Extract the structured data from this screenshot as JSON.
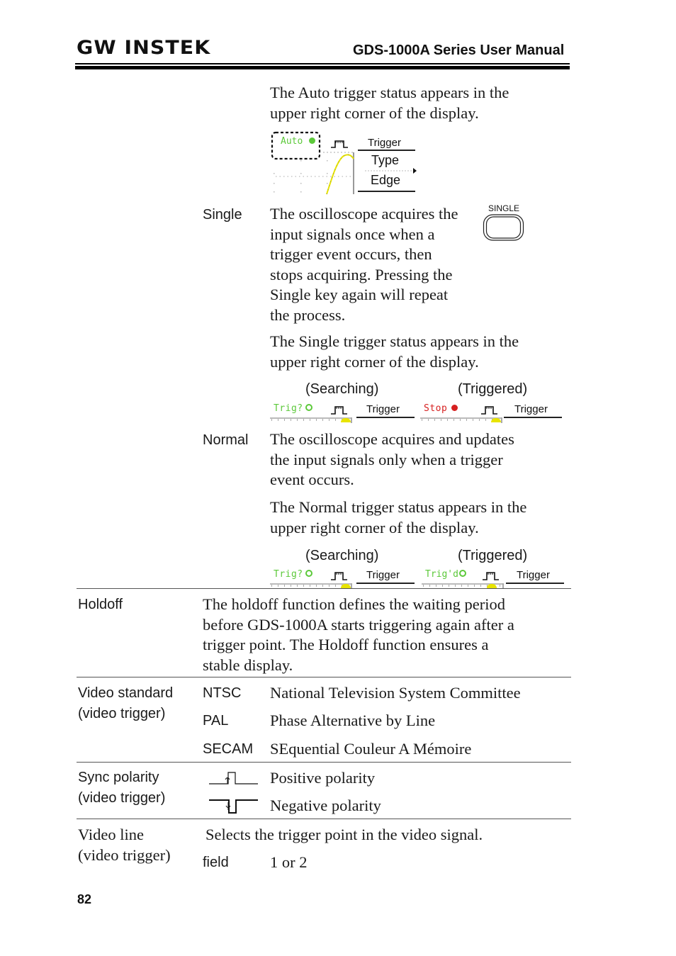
{
  "header": {
    "logo": "GW INSTEK",
    "manual_title": "GDS-1000A Series User Manual"
  },
  "auto": {
    "description": "The Auto trigger status appears in the upper right corner of the display.",
    "lines": [
      "The Auto trigger status appears in the",
      "upper right corner of the display."
    ],
    "screen": {
      "status": "Auto",
      "menu_title": "Trigger",
      "menu_item_label": "Type",
      "menu_item_value": "Edge"
    }
  },
  "single": {
    "label": "Single",
    "lines": [
      "The oscilloscope acquires the",
      "input signals once when a",
      "trigger event occurs, then",
      "stops acquiring. Pressing the",
      "Single key again will repeat",
      "the process."
    ],
    "key_label": "SINGLE",
    "status_lines": [
      "The Single trigger status appears in the",
      "upper right corner of the display."
    ],
    "searching_caption": "(Searching)",
    "triggered_caption": "(Triggered)",
    "searching_status": "Trig?",
    "triggered_status": "Stop",
    "trigger_label": "Trigger"
  },
  "normal": {
    "label": "Normal",
    "lines": [
      "The oscilloscope acquires and updates",
      "the input signals only when a trigger",
      "event occurs."
    ],
    "status_lines": [
      "The Normal trigger status appears in the",
      "upper right corner of the display."
    ],
    "searching_caption": "(Searching)",
    "triggered_caption": "(Triggered)",
    "searching_status": "Trig?",
    "triggered_status": "Trig'd",
    "trigger_label": "Trigger"
  },
  "holdoff": {
    "label": "Holdoff",
    "lines": [
      "The holdoff function defines the waiting period",
      "before GDS-1000A starts triggering again after a",
      "trigger point. The Holdoff function ensures a",
      "stable display."
    ]
  },
  "video_standard": {
    "label_lines": [
      "Video standard",
      "(video trigger)"
    ],
    "rows": [
      {
        "key": "NTSC",
        "value": "National Television System Committee"
      },
      {
        "key": "PAL",
        "value": "Phase Alternative by Line"
      },
      {
        "key": "SECAM",
        "value": "SEquential Couleur A Mémoire"
      }
    ]
  },
  "sync_polarity": {
    "label_lines": [
      "Sync polarity",
      "(video trigger)"
    ],
    "rows": [
      {
        "icon": "positive-polarity-icon",
        "value": "Positive polarity"
      },
      {
        "icon": "negative-polarity-icon",
        "value": "Negative polarity"
      }
    ]
  },
  "video_line": {
    "label_lines": [
      "Video line",
      "(video trigger)"
    ],
    "description": "Selects the trigger point in the video signal.",
    "field_key": "field",
    "field_value": "1 or 2"
  },
  "colors": {
    "status_green": "#5cc93a",
    "status_red": "#d62020",
    "waveform_yellow": "#e8e400"
  },
  "footer": {
    "page_number": "82"
  }
}
